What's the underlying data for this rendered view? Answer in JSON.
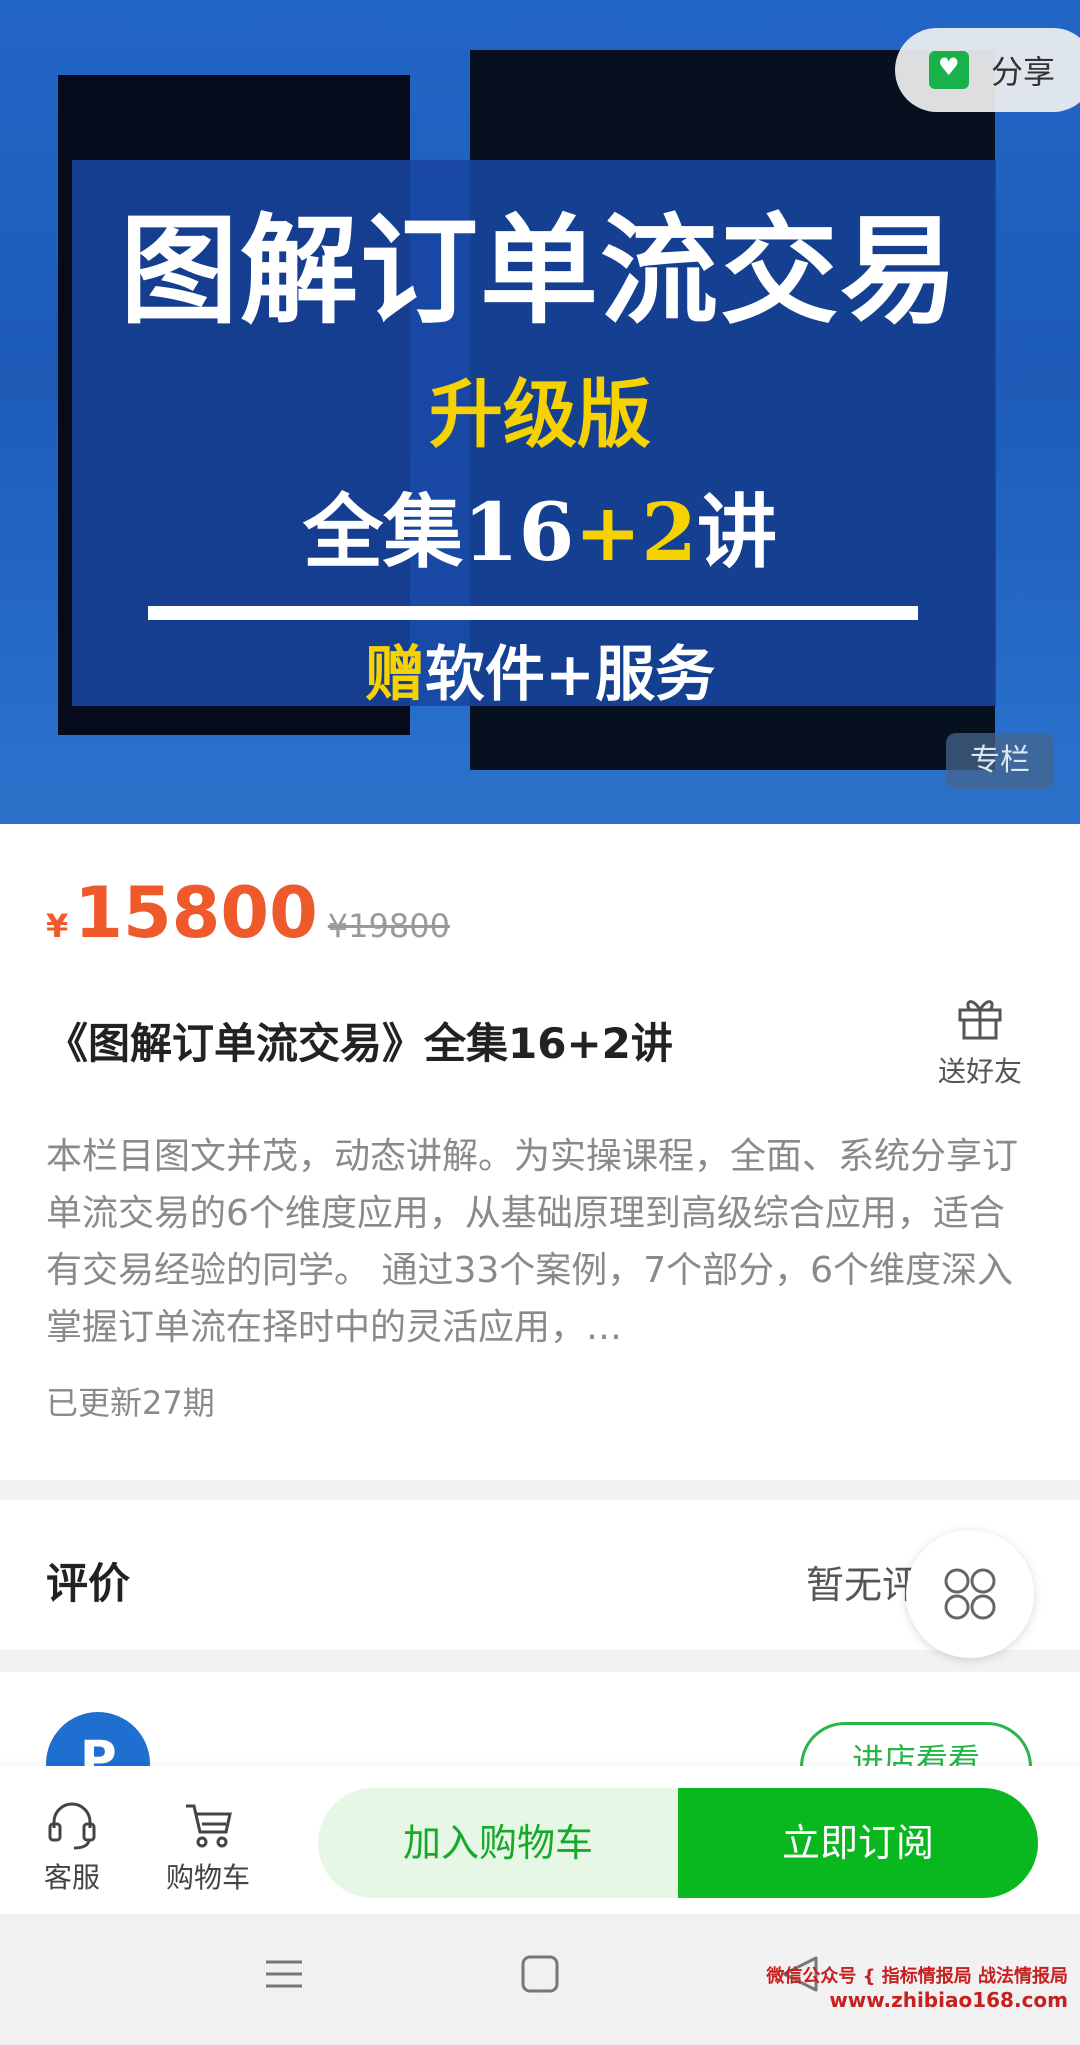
{
  "banner": {
    "title": "图解订单流交易",
    "subtitle_yellow": "升级版",
    "line2_prefix": "全集16",
    "line2_plus": "+",
    "line2_num": "2",
    "line2_suffix": "讲",
    "line3_yellow": "赠",
    "line3_rest": "软件+服务",
    "tag": "专栏"
  },
  "share": {
    "label": "分享",
    "icon": "wechat-heart-icon"
  },
  "price": {
    "currency": "¥",
    "current": "15800",
    "original": "¥19800"
  },
  "course": {
    "title": "《图解订单流交易》全集16+2讲",
    "gift_label": "送好友",
    "description": "本栏目图文并茂，动态讲解。为实操课程，全面、系统分享订单流交易的6个维度应用，从基础原理到高级综合应用，适合有交易经验的同学。 通过33个案例，7个部分，6个维度深入掌握订单流在择时中的灵活应用，…",
    "updated": "已更新27期"
  },
  "review": {
    "label": "评价",
    "empty_text": "暂无评"
  },
  "shop": {
    "visit_label": "进店看看"
  },
  "actionbar": {
    "service_label": "客服",
    "cart_label": "购物车",
    "add_cart_label": "加入购物车",
    "subscribe_label": "立即订阅",
    "accent": "#09b81f"
  },
  "watermark": {
    "line1": "微信公众号 { 指标情报局 战法情报局",
    "line2": "www.zhibiao168.com"
  }
}
